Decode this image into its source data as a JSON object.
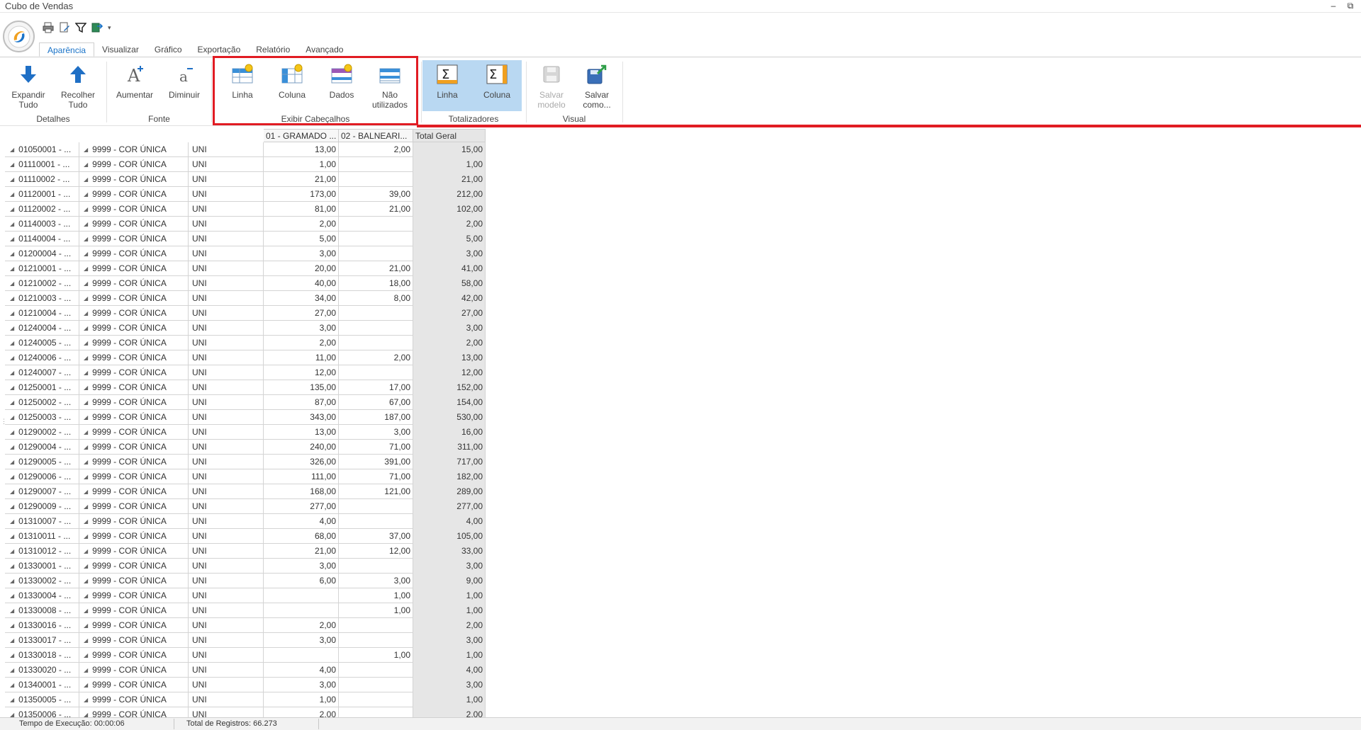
{
  "window": {
    "title": "Cubo de Vendas",
    "minimize_glyph": "–",
    "restore_glyph": "⧉"
  },
  "quick_access": [
    {
      "icon": "printer-icon"
    },
    {
      "icon": "document-edit-icon"
    },
    {
      "icon": "filter-icon"
    },
    {
      "icon": "export-icon"
    }
  ],
  "quick_access_more": "▾",
  "tabs": [
    {
      "label": "Aparência",
      "active": true
    },
    {
      "label": "Visualizar"
    },
    {
      "label": "Gráfico"
    },
    {
      "label": "Exportação"
    },
    {
      "label": "Relatório"
    },
    {
      "label": "Avançado"
    }
  ],
  "ribbon": {
    "detalhes": {
      "label": "Detalhes",
      "expand_line1": "Expandir",
      "expand_line2": "Tudo",
      "collapse_line1": "Recolher",
      "collapse_line2": "Tudo"
    },
    "fonte": {
      "label": "Fonte",
      "increase": "Aumentar",
      "decrease": "Diminuir"
    },
    "cabecalhos": {
      "label": "Exibir Cabeçalhos",
      "linha": "Linha",
      "coluna": "Coluna",
      "dados": "Dados",
      "nao_line1": "Não",
      "nao_line2": "utilizados"
    },
    "totalizadores": {
      "label": "Totalizadores",
      "linha": "Linha",
      "coluna": "Coluna"
    },
    "visual": {
      "label": "Visual",
      "save_line1": "Salvar",
      "save_line2": "modelo",
      "saveas_line1": "Salvar",
      "saveas_line2": "como..."
    }
  },
  "colors": {
    "highlight": "#e11c23",
    "accent": "#1a73c8",
    "pressed": "#b9d8f2",
    "total_bg": "#e6e6e6"
  },
  "grid": {
    "headers": {
      "col1": "01 - GRAMADO ...",
      "col2": "02 - BALNEARI...",
      "total": "Total Geral"
    },
    "rows": [
      {
        "produto": "01050001 - ...",
        "cor": "9999 - COR ÚNICA",
        "un": "UNI",
        "g": "13,00",
        "b": "2,00",
        "t": "15,00"
      },
      {
        "produto": "01110001 - ...",
        "cor": "9999 - COR ÚNICA",
        "un": "UNI",
        "g": "1,00",
        "b": "",
        "t": "1,00"
      },
      {
        "produto": "01110002 - ...",
        "cor": "9999 - COR ÚNICA",
        "un": "UNI",
        "g": "21,00",
        "b": "",
        "t": "21,00"
      },
      {
        "produto": "01120001 - ...",
        "cor": "9999 - COR ÚNICA",
        "un": "UNI",
        "g": "173,00",
        "b": "39,00",
        "t": "212,00"
      },
      {
        "produto": "01120002 - ...",
        "cor": "9999 - COR ÚNICA",
        "un": "UNI",
        "g": "81,00",
        "b": "21,00",
        "t": "102,00"
      },
      {
        "produto": "01140003 - ...",
        "cor": "9999 - COR ÚNICA",
        "un": "UNI",
        "g": "2,00",
        "b": "",
        "t": "2,00"
      },
      {
        "produto": "01140004 - ...",
        "cor": "9999 - COR ÚNICA",
        "un": "UNI",
        "g": "5,00",
        "b": "",
        "t": "5,00"
      },
      {
        "produto": "01200004 - ...",
        "cor": "9999 - COR ÚNICA",
        "un": "UNI",
        "g": "3,00",
        "b": "",
        "t": "3,00"
      },
      {
        "produto": "01210001 - ...",
        "cor": "9999 - COR ÚNICA",
        "un": "UNI",
        "g": "20,00",
        "b": "21,00",
        "t": "41,00"
      },
      {
        "produto": "01210002 - ...",
        "cor": "9999 - COR ÚNICA",
        "un": "UNI",
        "g": "40,00",
        "b": "18,00",
        "t": "58,00"
      },
      {
        "produto": "01210003 - ...",
        "cor": "9999 - COR ÚNICA",
        "un": "UNI",
        "g": "34,00",
        "b": "8,00",
        "t": "42,00"
      },
      {
        "produto": "01210004 - ...",
        "cor": "9999 - COR ÚNICA",
        "un": "UNI",
        "g": "27,00",
        "b": "",
        "t": "27,00"
      },
      {
        "produto": "01240004 - ...",
        "cor": "9999 - COR ÚNICA",
        "un": "UNI",
        "g": "3,00",
        "b": "",
        "t": "3,00"
      },
      {
        "produto": "01240005 - ...",
        "cor": "9999 - COR ÚNICA",
        "un": "UNI",
        "g": "2,00",
        "b": "",
        "t": "2,00"
      },
      {
        "produto": "01240006 - ...",
        "cor": "9999 - COR ÚNICA",
        "un": "UNI",
        "g": "11,00",
        "b": "2,00",
        "t": "13,00"
      },
      {
        "produto": "01240007 - ...",
        "cor": "9999 - COR ÚNICA",
        "un": "UNI",
        "g": "12,00",
        "b": "",
        "t": "12,00"
      },
      {
        "produto": "01250001 - ...",
        "cor": "9999 - COR ÚNICA",
        "un": "UNI",
        "g": "135,00",
        "b": "17,00",
        "t": "152,00"
      },
      {
        "produto": "01250002 - ...",
        "cor": "9999 - COR ÚNICA",
        "un": "UNI",
        "g": "87,00",
        "b": "67,00",
        "t": "154,00"
      },
      {
        "produto": "01250003 - ...",
        "cor": "9999 - COR ÚNICA",
        "un": "UNI",
        "g": "343,00",
        "b": "187,00",
        "t": "530,00"
      },
      {
        "produto": "01290002 - ...",
        "cor": "9999 - COR ÚNICA",
        "un": "UNI",
        "g": "13,00",
        "b": "3,00",
        "t": "16,00"
      },
      {
        "produto": "01290004 - ...",
        "cor": "9999 - COR ÚNICA",
        "un": "UNI",
        "g": "240,00",
        "b": "71,00",
        "t": "311,00"
      },
      {
        "produto": "01290005 - ...",
        "cor": "9999 - COR ÚNICA",
        "un": "UNI",
        "g": "326,00",
        "b": "391,00",
        "t": "717,00"
      },
      {
        "produto": "01290006 - ...",
        "cor": "9999 - COR ÚNICA",
        "un": "UNI",
        "g": "111,00",
        "b": "71,00",
        "t": "182,00"
      },
      {
        "produto": "01290007 - ...",
        "cor": "9999 - COR ÚNICA",
        "un": "UNI",
        "g": "168,00",
        "b": "121,00",
        "t": "289,00"
      },
      {
        "produto": "01290009 - ...",
        "cor": "9999 - COR ÚNICA",
        "un": "UNI",
        "g": "277,00",
        "b": "",
        "t": "277,00"
      },
      {
        "produto": "01310007 - ...",
        "cor": "9999 - COR ÚNICA",
        "un": "UNI",
        "g": "4,00",
        "b": "",
        "t": "4,00"
      },
      {
        "produto": "01310011 - ...",
        "cor": "9999 - COR ÚNICA",
        "un": "UNI",
        "g": "68,00",
        "b": "37,00",
        "t": "105,00"
      },
      {
        "produto": "01310012 - ...",
        "cor": "9999 - COR ÚNICA",
        "un": "UNI",
        "g": "21,00",
        "b": "12,00",
        "t": "33,00"
      },
      {
        "produto": "01330001 - ...",
        "cor": "9999 - COR ÚNICA",
        "un": "UNI",
        "g": "3,00",
        "b": "",
        "t": "3,00"
      },
      {
        "produto": "01330002 - ...",
        "cor": "9999 - COR ÚNICA",
        "un": "UNI",
        "g": "6,00",
        "b": "3,00",
        "t": "9,00"
      },
      {
        "produto": "01330004 - ...",
        "cor": "9999 - COR ÚNICA",
        "un": "UNI",
        "g": "",
        "b": "1,00",
        "t": "1,00"
      },
      {
        "produto": "01330008 - ...",
        "cor": "9999 - COR ÚNICA",
        "un": "UNI",
        "g": "",
        "b": "1,00",
        "t": "1,00"
      },
      {
        "produto": "01330016 - ...",
        "cor": "9999 - COR ÚNICA",
        "un": "UNI",
        "g": "2,00",
        "b": "",
        "t": "2,00"
      },
      {
        "produto": "01330017 - ...",
        "cor": "9999 - COR ÚNICA",
        "un": "UNI",
        "g": "3,00",
        "b": "",
        "t": "3,00"
      },
      {
        "produto": "01330018 - ...",
        "cor": "9999 - COR ÚNICA",
        "un": "UNI",
        "g": "",
        "b": "1,00",
        "t": "1,00"
      },
      {
        "produto": "01330020 - ...",
        "cor": "9999 - COR ÚNICA",
        "un": "UNI",
        "g": "4,00",
        "b": "",
        "t": "4,00"
      },
      {
        "produto": "01340001 - ...",
        "cor": "9999 - COR ÚNICA",
        "un": "UNI",
        "g": "3,00",
        "b": "",
        "t": "3,00"
      },
      {
        "produto": "01350005 - ...",
        "cor": "9999 - COR ÚNICA",
        "un": "UNI",
        "g": "1,00",
        "b": "",
        "t": "1,00"
      },
      {
        "produto": "01350006 - ...",
        "cor": "9999 - COR ÚNICA",
        "un": "UNI",
        "g": "2,00",
        "b": "",
        "t": "2,00"
      }
    ]
  },
  "status": {
    "exec_time": "Tempo de Execução: 00:00:06",
    "total_records": "Total de Registros: 66.273"
  }
}
